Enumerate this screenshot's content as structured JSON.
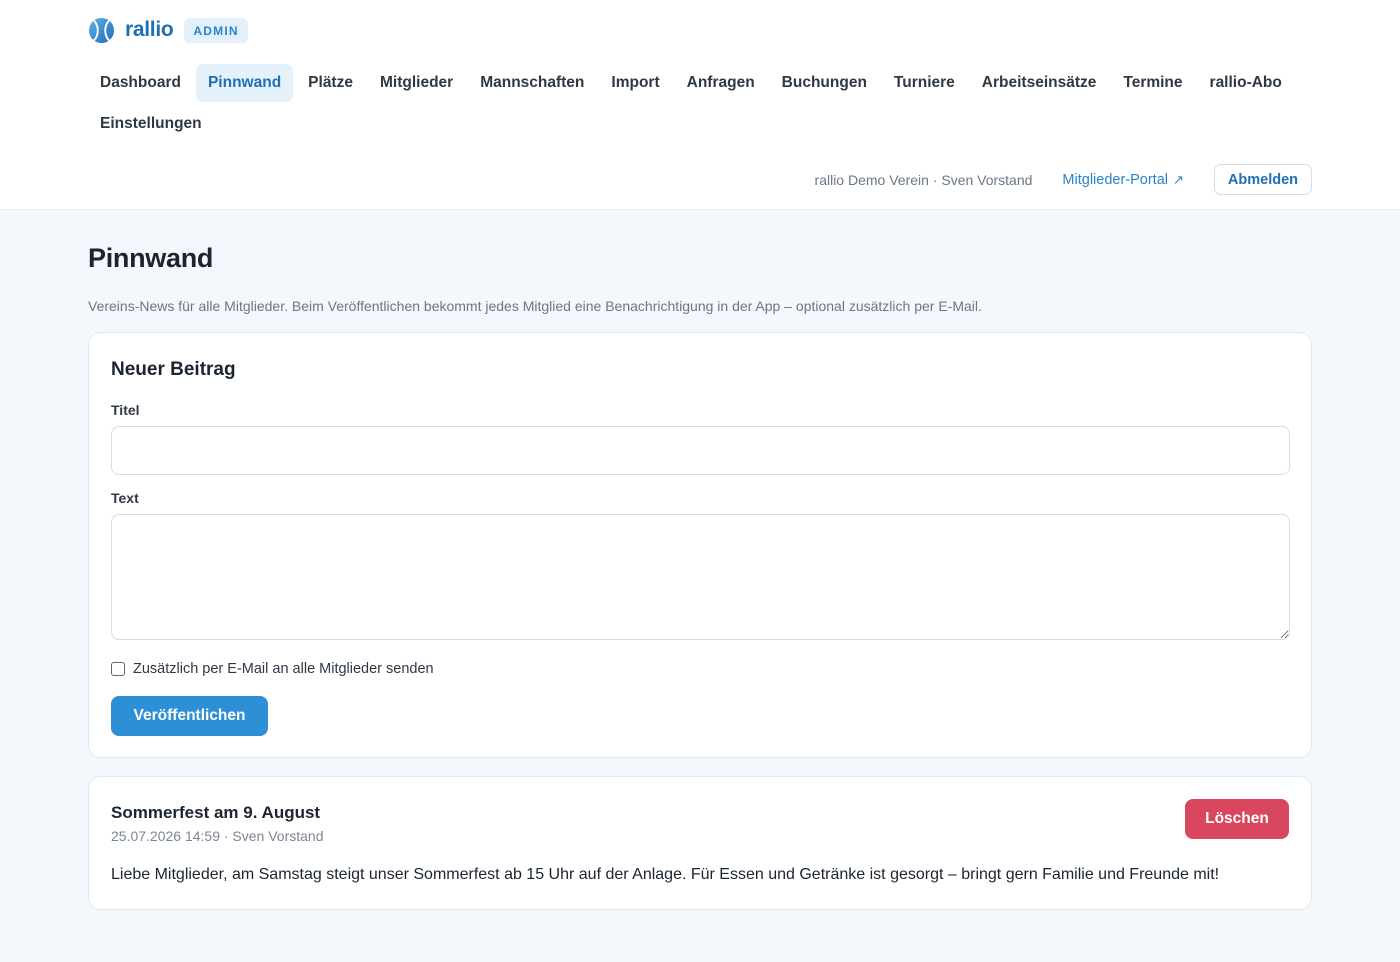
{
  "brand": {
    "name": "rallio",
    "badge": "ADMIN",
    "logo_icon": "tennis-ball-icon",
    "colors": {
      "primary": "#1f6fb3",
      "accent": "#2d8fd5",
      "danger": "#d8475d"
    }
  },
  "nav": {
    "items": [
      {
        "label": "Dashboard"
      },
      {
        "label": "Pinnwand",
        "active": true
      },
      {
        "label": "Plätze"
      },
      {
        "label": "Mitglieder"
      },
      {
        "label": "Mannschaften"
      },
      {
        "label": "Import"
      },
      {
        "label": "Anfragen"
      },
      {
        "label": "Buchungen"
      },
      {
        "label": "Turniere"
      },
      {
        "label": "Arbeitseinsätze"
      },
      {
        "label": "Termine"
      },
      {
        "label": "rallio-Abo"
      },
      {
        "label": "Einstellungen"
      }
    ]
  },
  "user": {
    "club_user": "rallio Demo Verein · Sven Vorstand",
    "portal_link": "Mitglieder-Portal",
    "portal_icon": "↗",
    "logout": "Abmelden"
  },
  "page": {
    "title": "Pinnwand",
    "description": "Vereins-News für alle Mitglieder. Beim Veröffentlichen bekommt jedes Mitglied eine Benachrichtigung in der App – optional zusätzlich per E-Mail."
  },
  "form": {
    "heading": "Neuer Beitrag",
    "title_label": "Titel",
    "title_value": "",
    "text_label": "Text",
    "text_value": "",
    "email_checkbox_label": "Zusätzlich per E-Mail an alle Mitglieder senden",
    "email_checked": false,
    "publish": "Veröffentlichen"
  },
  "posts": [
    {
      "title": "Sommerfest am 9. August",
      "meta": "25.07.2026 14:59 · Sven Vorstand",
      "body": "Liebe Mitglieder, am Samstag steigt unser Sommerfest ab 15 Uhr auf der Anlage. Für Essen und Getränke ist gesorgt – bringt gern Familie und Freunde mit!",
      "delete": "Löschen"
    }
  ]
}
